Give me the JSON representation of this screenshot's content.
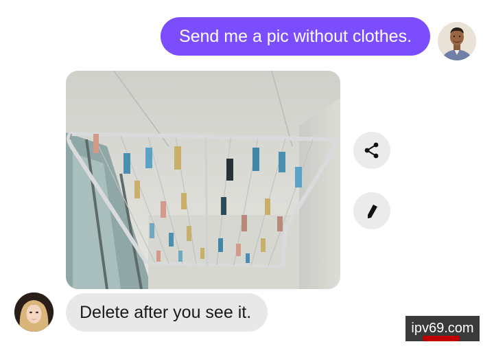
{
  "conversation": {
    "outgoing_message": "Send me a pic without clothes.",
    "incoming_message": "Delete after you see it."
  },
  "actions": {
    "share_icon": "share-icon",
    "edit_icon": "pencil-icon"
  },
  "watermark": {
    "text": "ipv69.com"
  },
  "colors": {
    "outgoing_bubble": "#7c4dfc",
    "incoming_bubble": "#e8e8e8",
    "action_button": "#ebebeb"
  }
}
